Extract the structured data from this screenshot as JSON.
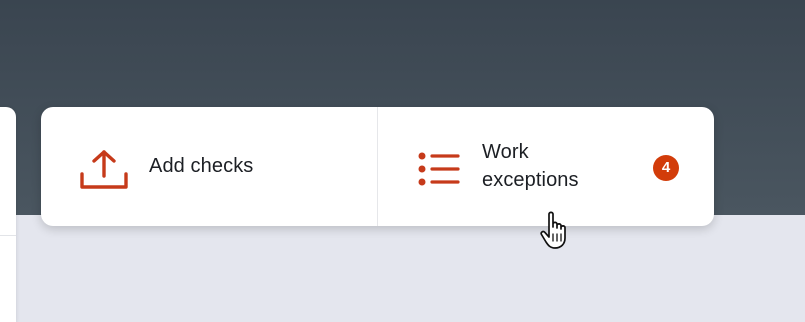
{
  "actions": {
    "add_checks": {
      "label": "Add checks",
      "icon": "upload-icon"
    },
    "work_exceptions": {
      "label": "Work\nexceptions",
      "icon": "list-icon",
      "badge_count": "4"
    }
  },
  "colors": {
    "header_background": "#3e4953",
    "page_background": "#e4e6ee",
    "accent": "#c63a1a",
    "badge": "#d23c0a",
    "card": "#ffffff"
  },
  "cursor": "hand-pointer-icon"
}
